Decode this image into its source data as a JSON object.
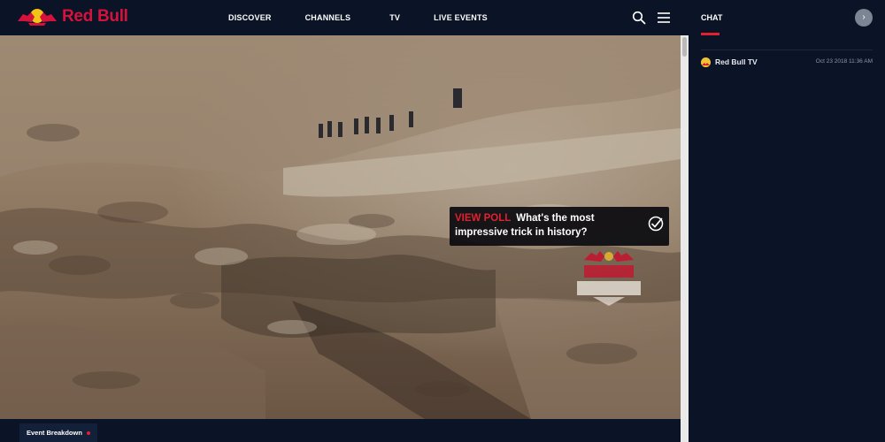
{
  "brand": {
    "name": "Red Bull",
    "color": "#d6123c"
  },
  "nav": {
    "items": [
      {
        "label": "DISCOVER"
      },
      {
        "label": "CHANNELS"
      },
      {
        "label": "TV"
      },
      {
        "label": "LIVE EVENTS"
      }
    ],
    "icons": [
      "search-icon",
      "menu-icon"
    ]
  },
  "poll": {
    "cta": "VIEW POLL",
    "question": "What's the most impressive trick in history?",
    "icon": "check-circle-icon"
  },
  "video": {
    "watermark_icon": "red-bull-rampage-logo"
  },
  "bottom": {
    "tab_label": "Event Breakdown"
  },
  "chat": {
    "tab_label": "CHAT",
    "next_icon": "chevron-right-icon",
    "messages": [
      {
        "author": "Red Bull TV",
        "timestamp": "Oct 23 2018 11:36 AM"
      }
    ]
  },
  "colors": {
    "accent": "#e3202f",
    "background": "#0a1426"
  }
}
